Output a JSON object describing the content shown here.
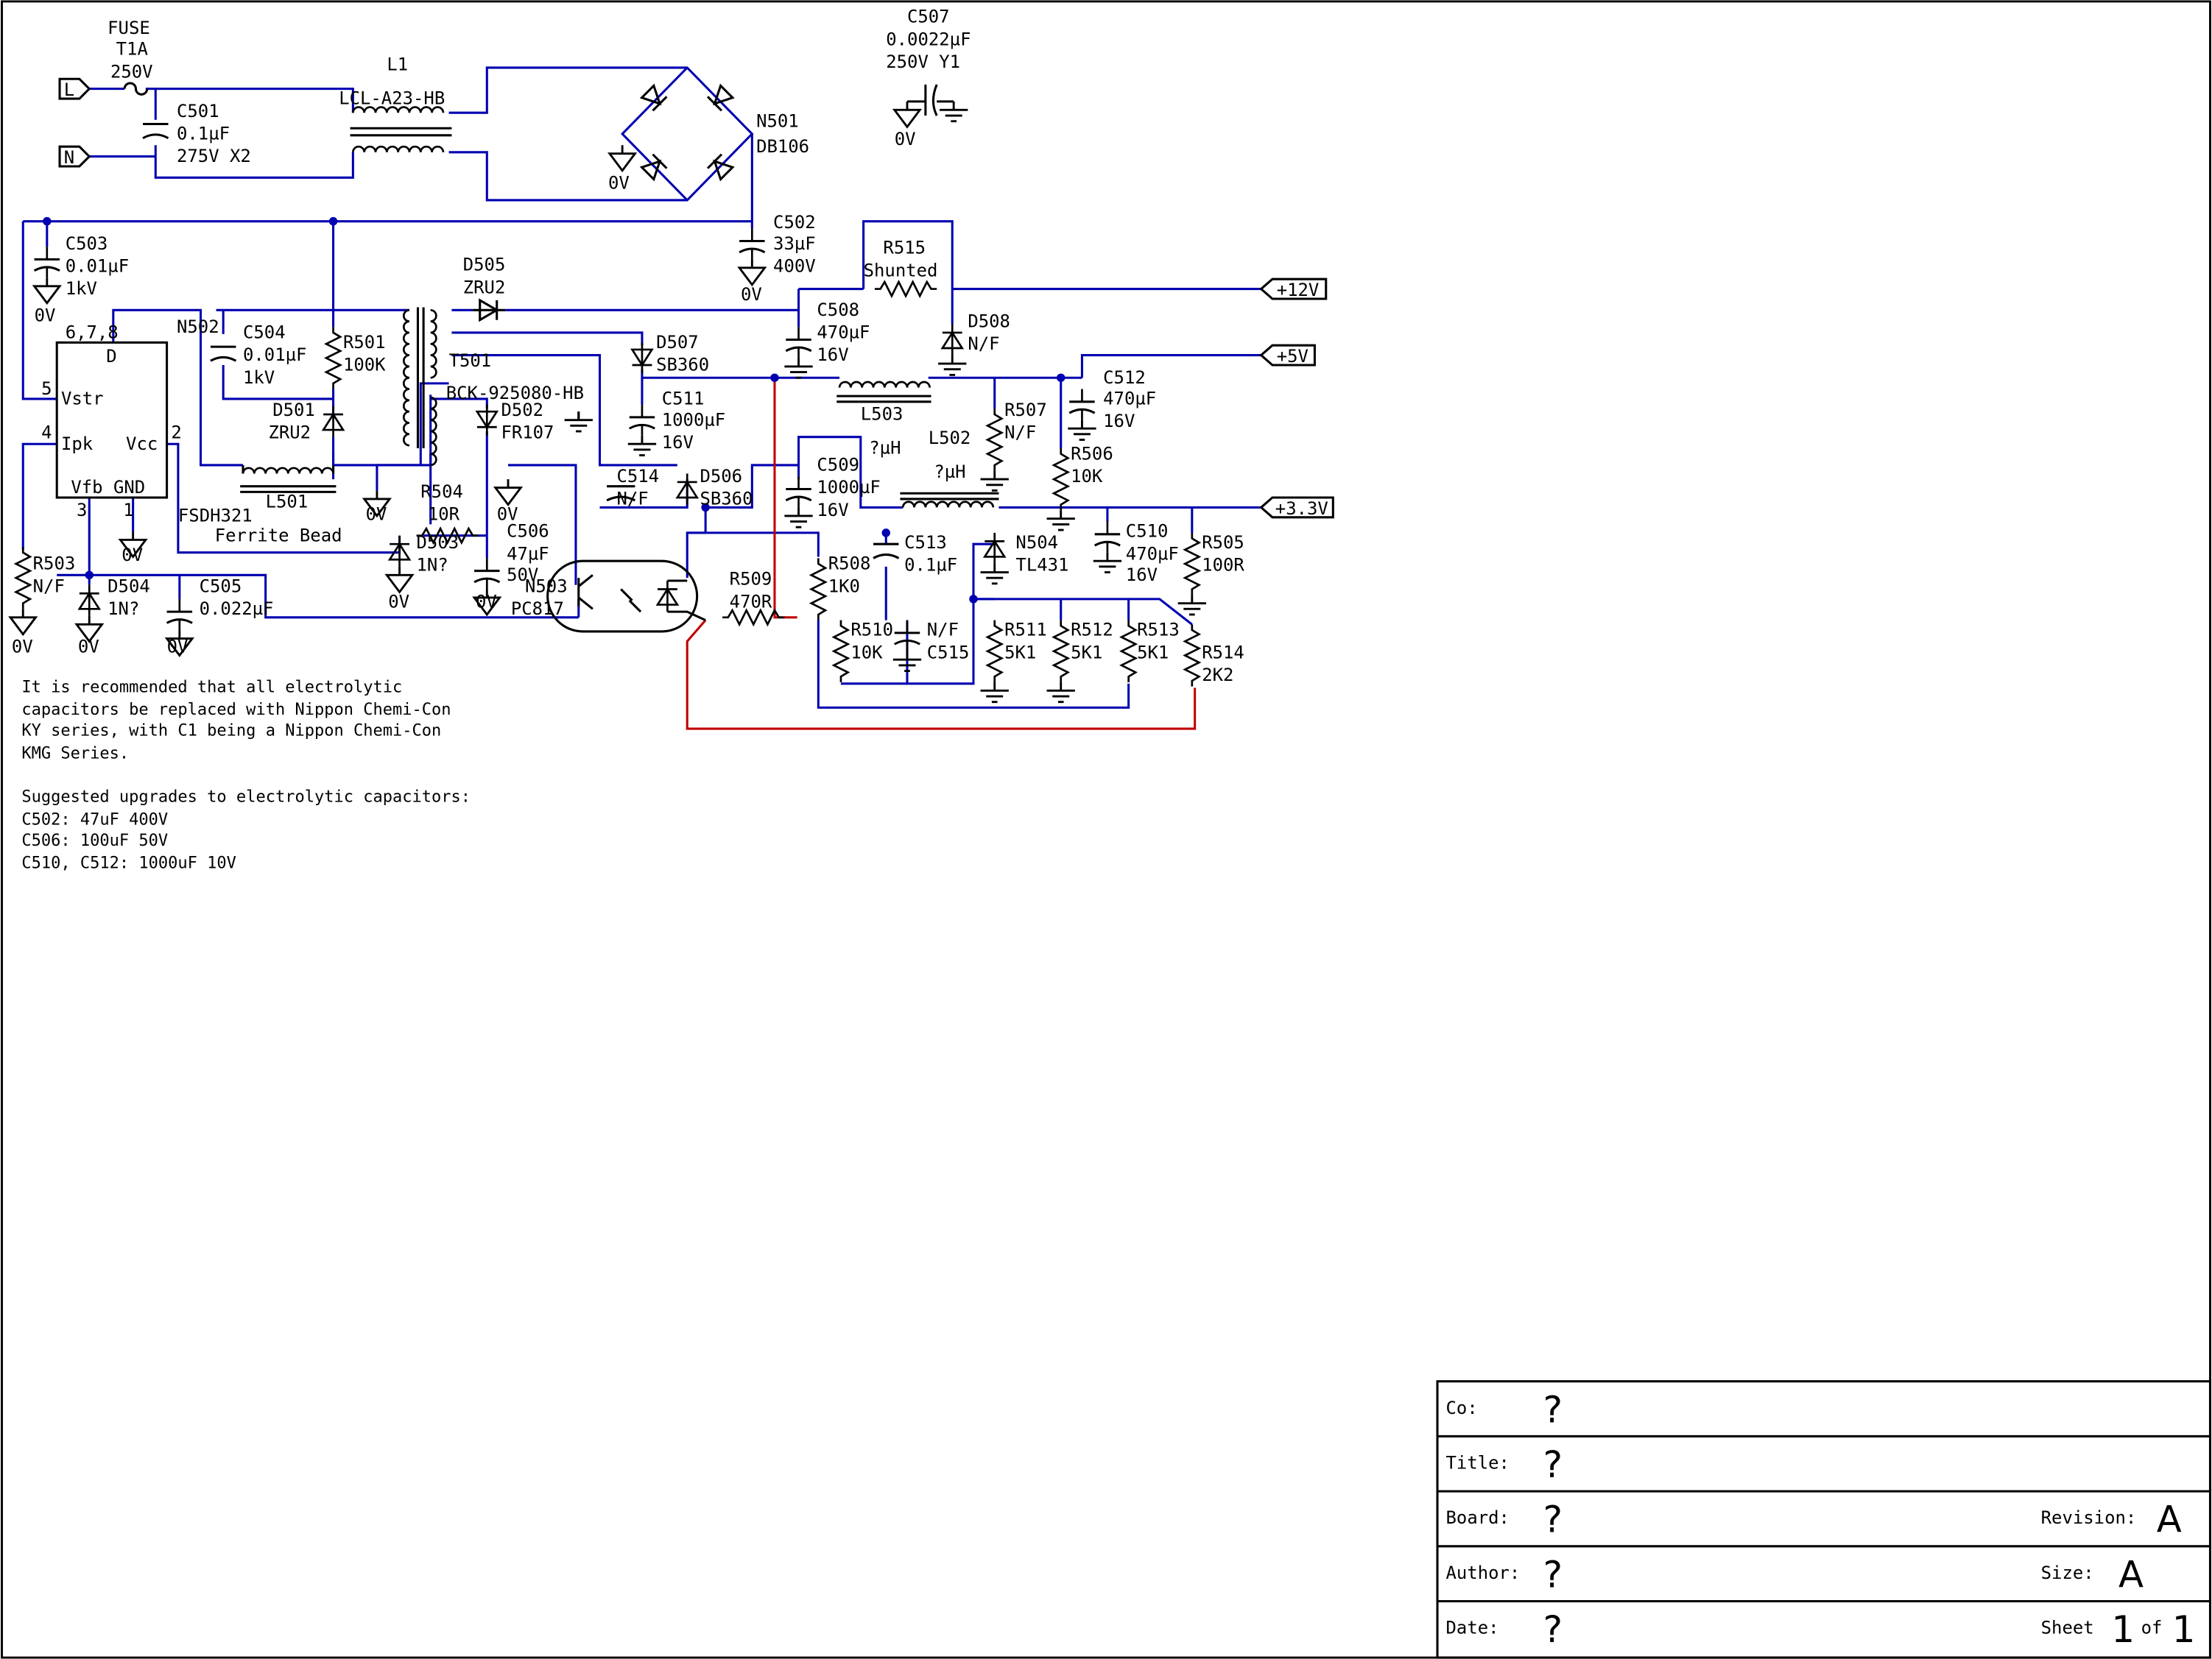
{
  "labels": {
    "fuse": [
      "FUSE",
      "T1A",
      "250V"
    ],
    "c507": [
      "C507",
      "0.0022µF",
      "250V  Y1"
    ],
    "L1": [
      "L1",
      "LCL-A23-HB"
    ],
    "c501": [
      "C501",
      "0.1µF",
      "275V X2"
    ],
    "n501": [
      "N501",
      "DB106"
    ],
    "c502": [
      "C502",
      "33µF",
      "400V"
    ],
    "c503": [
      "C503",
      "0.01µF",
      "1kV"
    ],
    "d505": [
      "D505",
      "ZRU2"
    ],
    "r515": [
      "R515",
      "Shunted"
    ],
    "c508": [
      "C508",
      "470µF",
      "16V"
    ],
    "d508": [
      "D508",
      "N/F"
    ],
    "c504": [
      "C504",
      "0.01µF",
      "1kV"
    ],
    "r501": [
      "R501",
      "100K"
    ],
    "d501": [
      "D501",
      "ZRU2"
    ],
    "d507": [
      "D507",
      "SB360"
    ],
    "c511": [
      "C511",
      "1000µF",
      "16V"
    ],
    "t501": [
      "T501",
      "BCK-925080-HB"
    ],
    "d502": [
      "D502",
      "FR107"
    ],
    "l503": "L503",
    "r507": [
      "R507",
      "N/F"
    ],
    "c512": [
      "C512",
      "470µF",
      "16V"
    ],
    "r506": [
      "R506",
      "10K"
    ],
    "l501": "L501",
    "fsdh": [
      "FSDH321",
      "Ferrite Bead"
    ],
    "r504": [
      "R504",
      "10R"
    ],
    "d503": [
      "D503",
      "1N?"
    ],
    "c506": [
      "C506",
      "47µF",
      "50V"
    ],
    "c514": [
      "C514",
      "N/F"
    ],
    "d506": [
      "D506",
      "SB360"
    ],
    "c509": [
      "C509",
      "1000µF",
      "16V"
    ],
    "l502": [
      "?µH",
      "L502",
      "?µH"
    ],
    "n503": [
      "N503",
      "PC817"
    ],
    "r509": [
      "R509",
      "470R"
    ],
    "r508": [
      "R508",
      "1K0"
    ],
    "c513": [
      "C513",
      "0.1µF"
    ],
    "n504": [
      "N504",
      "TL431"
    ],
    "c510": [
      "C510",
      "470µF",
      "16V"
    ],
    "r505": [
      "R505",
      "100R"
    ],
    "r510": [
      "R510",
      "10K"
    ],
    "c515": [
      "N/F",
      "C515"
    ],
    "r511": [
      "R511",
      "5K1"
    ],
    "r512": [
      "R512",
      "5K1"
    ],
    "r513": [
      "R513",
      "5K1"
    ],
    "r514": [
      "R514",
      "2K2"
    ],
    "r503": [
      "R503",
      "N/F"
    ],
    "d504": [
      "D504",
      "1N?"
    ],
    "c505": [
      "C505",
      "0.022µF"
    ],
    "n502": "N502",
    "ic": {
      "pins": [
        "6,7,8",
        "5",
        "4",
        "2",
        "3",
        "1"
      ],
      "names": [
        "D",
        "Vstr",
        "Ipk",
        "Vcc",
        "Vfb GND"
      ]
    },
    "ports": {
      "L": "L",
      "N": "N",
      "p12v": "+12V",
      "p5v": "+5V",
      "p33v": "+3.3V"
    },
    "ground": "0V"
  },
  "notes": [
    "It is recommended that all electrolytic",
    "capacitors be replaced with Nippon Chemi-Con",
    "KY series, with C1 being a Nippon Chemi-Con",
    "KMG Series.",
    "",
    "Suggested upgrades to electrolytic capacitors:",
    "C502: 47uF 400V",
    "C506: 100uF 50V",
    "C510, C512: 1000uF 10V"
  ],
  "title_block": {
    "co_label": "Co:",
    "co": "?",
    "title_label": "Title:",
    "title": "?",
    "board_label": "Board:",
    "board": "?",
    "revision_label": "Revision:",
    "revision": "A",
    "author_label": "Author:",
    "author": "?",
    "size_label": "Size:",
    "size": "A",
    "date_label": "Date:",
    "date": "?",
    "sheet_label": "Sheet",
    "sheet": "1",
    "of_label": "of",
    "of": "1"
  }
}
